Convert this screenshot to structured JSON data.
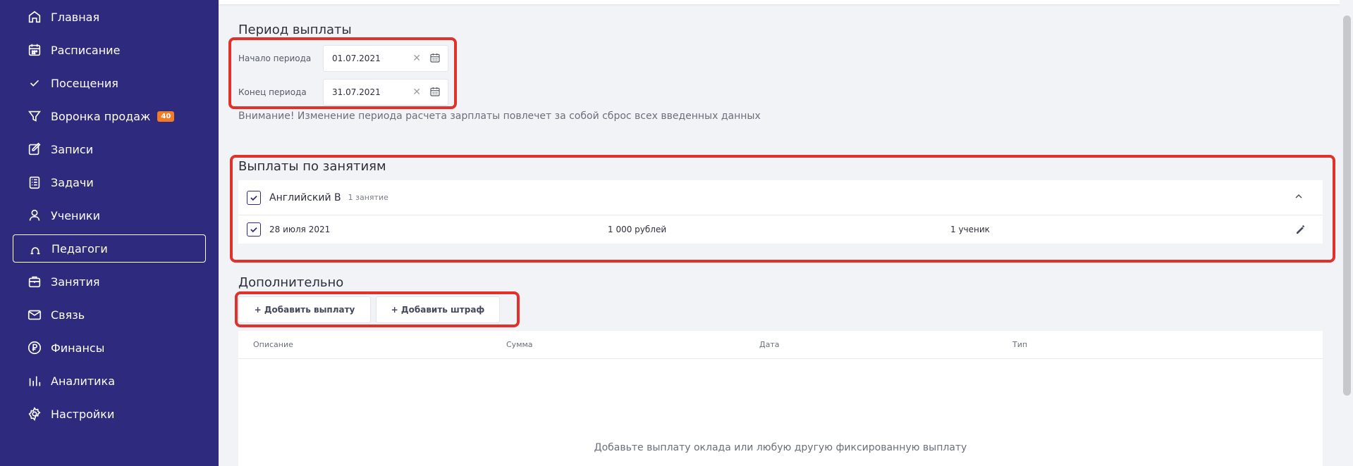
{
  "sidebar": {
    "items": [
      {
        "label": "Главная",
        "icon": "home-icon"
      },
      {
        "label": "Расписание",
        "icon": "calendar-icon"
      },
      {
        "label": "Посещения",
        "icon": "check-icon"
      },
      {
        "label": "Воронка продаж",
        "icon": "funnel-icon",
        "badge": "40"
      },
      {
        "label": "Записи",
        "icon": "edit-icon"
      },
      {
        "label": "Задачи",
        "icon": "tasks-icon"
      },
      {
        "label": "Ученики",
        "icon": "user-icon"
      },
      {
        "label": "Педагоги",
        "icon": "teacher-icon",
        "active": true
      },
      {
        "label": "Занятия",
        "icon": "briefcase-icon"
      },
      {
        "label": "Связь",
        "icon": "mail-icon"
      },
      {
        "label": "Финансы",
        "icon": "ruble-icon"
      },
      {
        "label": "Аналитика",
        "icon": "bar-chart-icon"
      },
      {
        "label": "Настройки",
        "icon": "gear-icon"
      }
    ]
  },
  "period": {
    "title": "Период выплаты",
    "start_label": "Начало периода",
    "start_value": "01.07.2021",
    "end_label": "Конец периода",
    "end_value": "31.07.2021",
    "warning": "Внимание! Изменение периода расчета зарплаты повлечет за собой сброс всех введенных данных"
  },
  "payments": {
    "title": "Выплаты по занятиям",
    "lesson_name": "Английский B",
    "lesson_count": "1 занятие",
    "session_date": "28 июля 2021",
    "session_amount": "1 000 рублей",
    "session_students": "1 ученик"
  },
  "extra": {
    "title": "Дополнительно",
    "add_payment": "+ Добавить выплату",
    "add_fine": "+ Добавить штраф",
    "columns": [
      "Описание",
      "Сумма",
      "Дата",
      "Тип"
    ],
    "empty_text": "Добавьте выплату оклада или любую другую фиксированную выплату"
  },
  "colors": {
    "sidebar_bg": "#2e2a7e",
    "badge": "#f27b26",
    "highlight": "#e0312b",
    "background": "#f2f3f6"
  }
}
